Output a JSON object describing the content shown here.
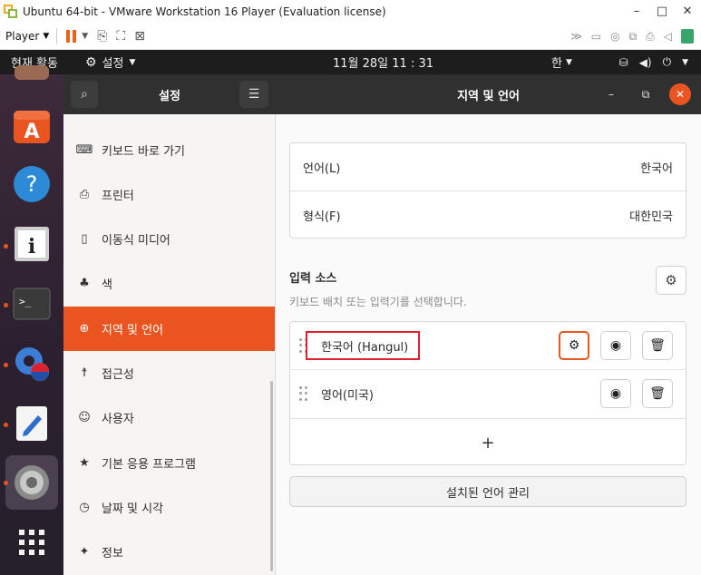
{
  "vmware": {
    "title": "Ubuntu 64-bit - VMware Workstation 16 Player (Evaluation license)",
    "player_label": "Player"
  },
  "topbar": {
    "activities": "현재 활동",
    "app_menu": "설정",
    "clock": "11월 28일  11 : 31",
    "input_method": "한"
  },
  "sidebar": {
    "title": "설정",
    "items": [
      {
        "label": "키보드 바로 가기",
        "icon": "keyboard-icon"
      },
      {
        "label": "프린터",
        "icon": "printer-icon"
      },
      {
        "label": "이동식 미디어",
        "icon": "removable-media-icon"
      },
      {
        "label": "색",
        "icon": "color-icon"
      },
      {
        "label": "지역 및 언어",
        "icon": "globe-icon",
        "active": true
      },
      {
        "label": "접근성",
        "icon": "accessibility-icon"
      },
      {
        "label": "사용자",
        "icon": "users-icon"
      },
      {
        "label": "기본 응용 프로그램",
        "icon": "star-icon"
      },
      {
        "label": "날짜 및 시각",
        "icon": "clock-icon"
      },
      {
        "label": "정보",
        "icon": "info-icon"
      }
    ]
  },
  "main": {
    "title": "지역 및 언어",
    "language": {
      "label": "언어(L)",
      "value": "한국어"
    },
    "formats": {
      "label": "형식(F)",
      "value": "대한민국"
    },
    "input_sources": {
      "title": "입력 소스",
      "description": "키보드 배치 또는 입력기를 선택합니다.",
      "sources": [
        {
          "label": "한국어 (Hangul)"
        },
        {
          "label": "영어(미국)"
        }
      ],
      "add_label": "+"
    },
    "manage_languages_label": "설치된 언어 관리"
  },
  "colors": {
    "accent": "#e95420",
    "dark_header": "#303030",
    "highlight_box": "#d9232e"
  }
}
